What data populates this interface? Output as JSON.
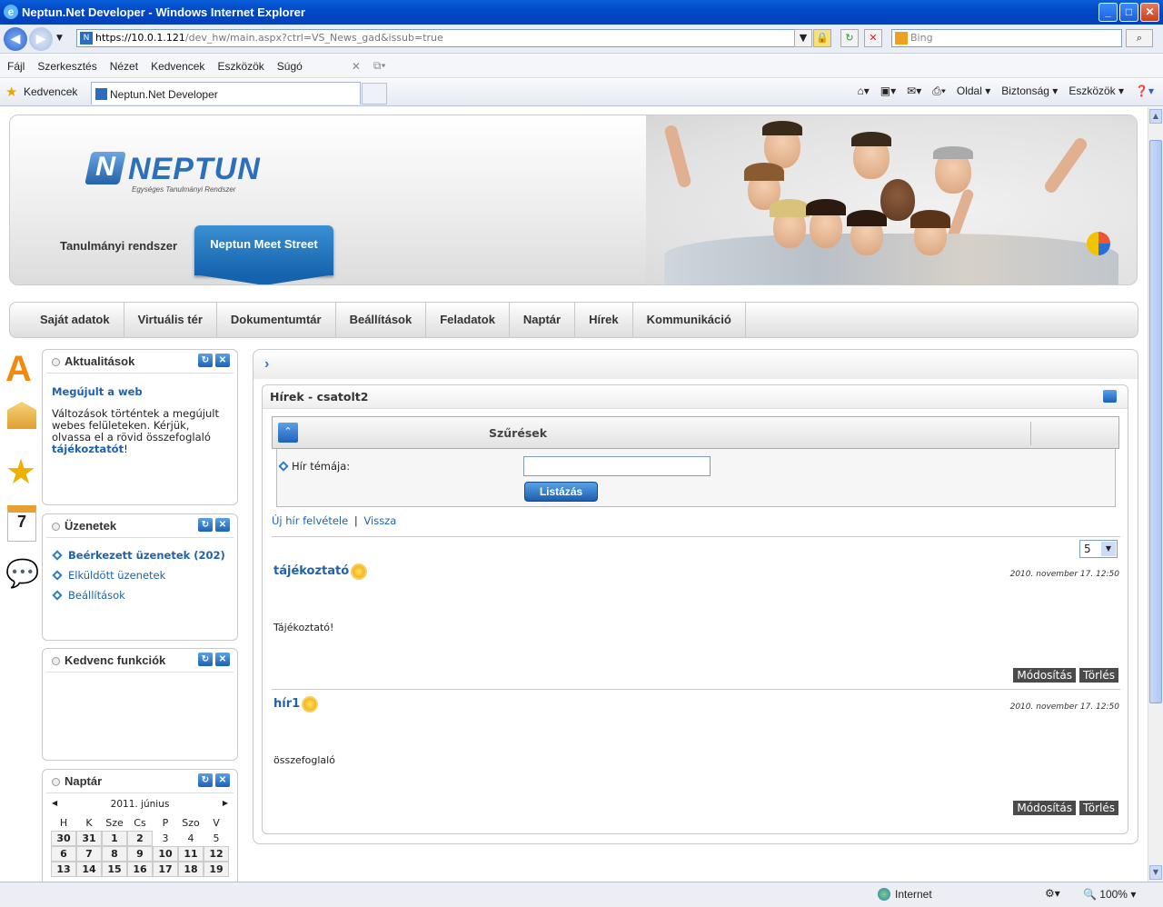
{
  "window": {
    "title": "Neptun.Net Developer - Windows Internet Explorer"
  },
  "address": {
    "host": "https://10.0.1.121",
    "path": "/dev_hw/main.aspx?ctrl=VS_News_gad&issub=true",
    "search_placeholder": "Bing"
  },
  "menu": [
    "Fájl",
    "Szerkesztés",
    "Nézet",
    "Kedvencek",
    "Eszközök",
    "Súgó"
  ],
  "favorites": {
    "label": "Kedvencek",
    "tab": "Neptun.Net Developer",
    "cmds": [
      "Oldal",
      "Biztonság",
      "Eszközök"
    ]
  },
  "status": {
    "zone": "Internet",
    "zoom": "100%"
  },
  "header": {
    "logo": "NEPTUN",
    "logo_sub": "Egységes Tanulmányi Rendszer",
    "tab1": "Tanulmányi rendszer",
    "tab2": "Neptun Meet Street"
  },
  "nav": [
    "Saját adatok",
    "Virtuális tér",
    "Dokumentumtár",
    "Beállítások",
    "Feladatok",
    "Naptár",
    "Hírek",
    "Kommunikáció"
  ],
  "aktualitasok": {
    "title": "Aktualitások",
    "heading": "Megújult a web",
    "text": "Változások történtek a megújult webes felületeken. Kérjük, olvassa el a rövid összefoglaló",
    "link": "tájékoztatót",
    "tail": "!"
  },
  "uzenetek": {
    "title": "Üzenetek",
    "items": [
      "Beérkezett üzenetek (202)",
      "Elküldött üzenetek",
      "Beállítások"
    ]
  },
  "kedvenc": {
    "title": "Kedvenc funkciók"
  },
  "naptar": {
    "title": "Naptár",
    "month": "2011. június",
    "days": [
      "H",
      "K",
      "Sze",
      "Cs",
      "P",
      "Szo",
      "V"
    ],
    "rows": [
      [
        "30",
        "31",
        "1",
        "2",
        "3",
        "4",
        "5"
      ],
      [
        "6",
        "7",
        "8",
        "9",
        "10",
        "11",
        "12"
      ],
      [
        "13",
        "14",
        "15",
        "16",
        "17",
        "18",
        "19"
      ]
    ]
  },
  "main": {
    "panel_title": "Hírek - csatolt2",
    "filter_title": "Szűrések",
    "field_label": "Hír témája:",
    "list_button": "Listázás",
    "link_new": "Új hír felvétele",
    "link_sep": "|",
    "link_back": "Vissza",
    "page_size": "5",
    "news": [
      {
        "title": "tájékoztató",
        "date": "2010. november 17. 12:50",
        "body": "Tájékoztató!",
        "edit": "Módosítás",
        "delete": "Törlés"
      },
      {
        "title": "hír1",
        "date": "2010. november 17. 12:50",
        "body": "összefoglaló",
        "edit": "Módosítás",
        "delete": "Törlés"
      }
    ]
  }
}
